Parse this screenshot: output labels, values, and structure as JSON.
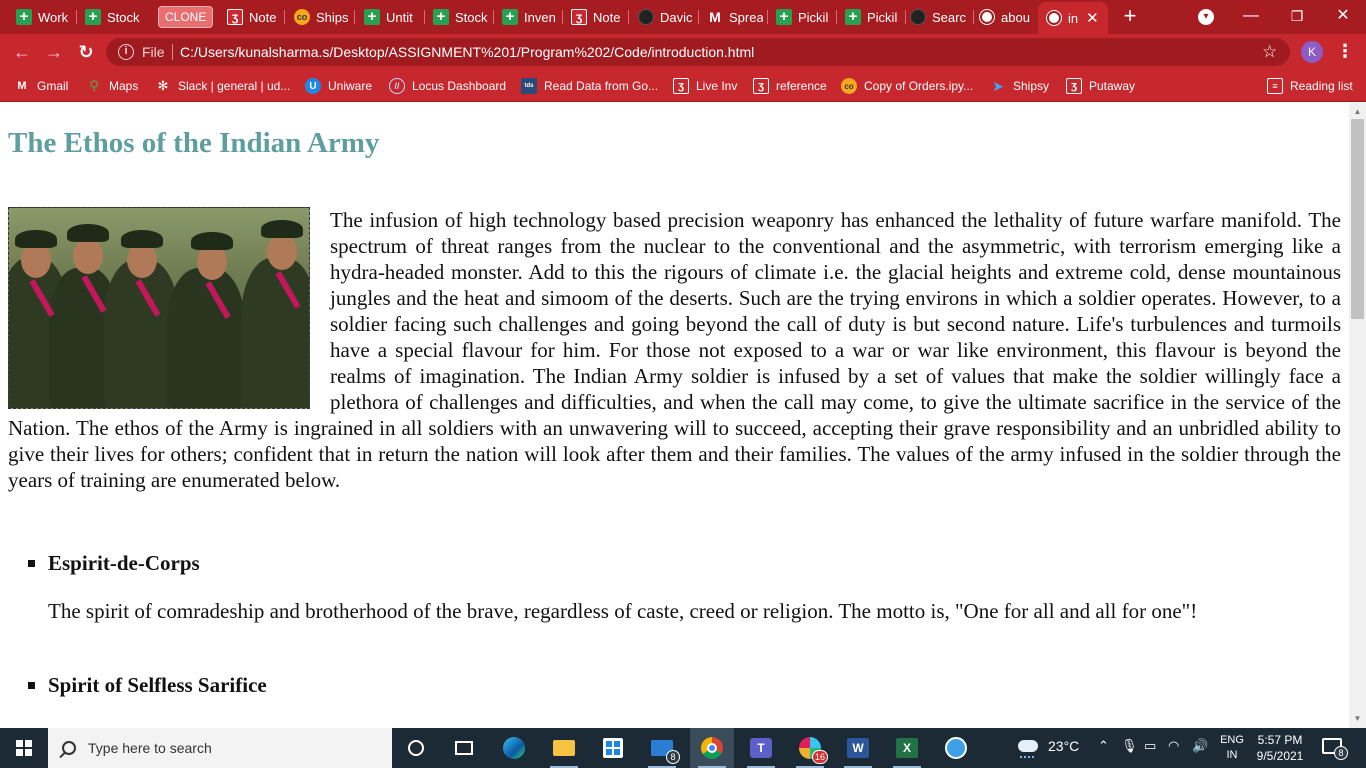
{
  "browser": {
    "tabs": [
      {
        "label": "Work",
        "icon": "sheets-icon"
      },
      {
        "label": "Stock",
        "icon": "sheets-icon"
      },
      {
        "label": "CLONE",
        "icon": ""
      },
      {
        "label": "Note",
        "icon": "notebook-icon"
      },
      {
        "label": "Ships",
        "icon": "colab-icon"
      },
      {
        "label": "Untit",
        "icon": "sheets-icon"
      },
      {
        "label": "Stock",
        "icon": "sheets-icon"
      },
      {
        "label": "Inven",
        "icon": "sheets-icon"
      },
      {
        "label": "Note",
        "icon": "notebook-icon"
      },
      {
        "label": "Davic",
        "icon": "github-icon"
      },
      {
        "label": "Sprea",
        "icon": "gmail-icon"
      },
      {
        "label": "Pickil",
        "icon": "sheets-icon"
      },
      {
        "label": "Pickil",
        "icon": "sheets-icon"
      },
      {
        "label": "Searc",
        "icon": "github-icon"
      },
      {
        "label": "abou",
        "icon": "globe-icon"
      },
      {
        "label": "in",
        "icon": "globe-icon"
      }
    ],
    "address": {
      "scheme_label": "File",
      "url": "C:/Users/kunalsharma.s/Desktop/ASSIGNMENT%201/Program%202/Code/introduction.html"
    },
    "profile_initial": "K",
    "bookmarks": [
      {
        "label": "Gmail",
        "icon": "gmail-icon"
      },
      {
        "label": "Maps",
        "icon": "maps-icon"
      },
      {
        "label": "Slack | general | ud...",
        "icon": "slack-icon"
      },
      {
        "label": "Uniware",
        "icon": "uniware-icon"
      },
      {
        "label": "Locus Dashboard",
        "icon": "locus-icon"
      },
      {
        "label": "Read Data from Go...",
        "icon": "tds-icon"
      },
      {
        "label": "Live Inv",
        "icon": "notebook-icon"
      },
      {
        "label": "reference",
        "icon": "notebook-icon"
      },
      {
        "label": "Copy of Orders.ipy...",
        "icon": "colab-icon"
      },
      {
        "label": "Shipsy",
        "icon": "shipsy-icon"
      },
      {
        "label": "Putaway",
        "icon": "notebook-icon"
      }
    ],
    "reading_list": "Reading list",
    "accent_color": "#c6282e",
    "tabstrip_color": "#a61c21"
  },
  "page": {
    "title": "The Ethos of the Indian Army",
    "title_color": "#5f9ea0",
    "intro": "The infusion of high technology based precision weaponry has enhanced the lethality of future warfare manifold. The spectrum of threat ranges from the nuclear to the conventional and the asymmetric, with terrorism emerging like a hydra-headed monster. Add to this the rigours of climate i.e. the glacial heights and extreme cold, dense mountainous jungles and the heat and simoom of the deserts. Such are the trying environs in which a soldier operates. However, to a soldier facing such challenges and going beyond the call of duty is but second nature. Life's turbulences and turmoils have a special flavour for him. For those not exposed to a war or war like environment, this flavour is beyond the realms of imagination. The Indian Army soldier is infused by a set of values that make the soldier willingly face a plethora of challenges and difficulties, and when the call may come, to give the ultimate sacrifice in the service of the Nation. The ethos of the Army is ingrained in all soldiers with an unwavering will to succeed, accepting their grave responsibility and an unbridled ability to give their lives for others; confident that in return the nation will look after them and their families. The values of the army infused in the soldier through the years of training are enumerated below.",
    "values": [
      {
        "title": "Espirit-de-Corps",
        "desc": "The spirit of comradeship and brotherhood of the brave, regardless of caste, creed or religion. The motto is, \"One for all and all for one\"!"
      },
      {
        "title": "Spirit of Selfless Sarifice",
        "desc": ""
      }
    ]
  },
  "taskbar": {
    "search_placeholder": "Type here to search",
    "mail_badge": "8",
    "slack_badge": "16",
    "temperature": "23°C",
    "language_line1": "ENG",
    "language_line2": "IN",
    "time": "5:57 PM",
    "date": "9/5/2021",
    "notification_badge": "8"
  }
}
